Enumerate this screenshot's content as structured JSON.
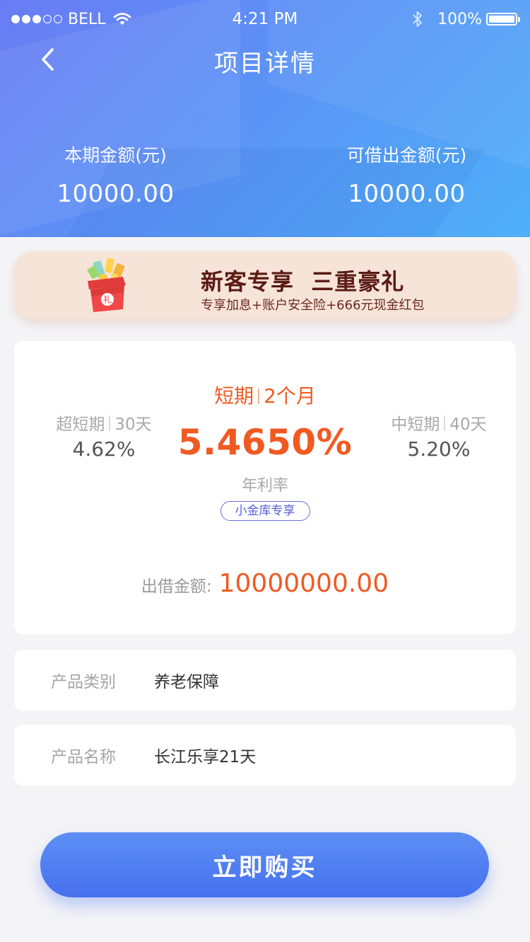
{
  "status_bar": {
    "carrier": "BELL",
    "time": "4:21 PM",
    "battery": "100%",
    "signal_bars_filled": 3,
    "signal_bars_total": 5
  },
  "nav": {
    "title": "项目详情",
    "back_icon": "chevron-left-icon"
  },
  "summary": {
    "current_amount_label": "本期金额(元)",
    "current_amount_value": "10000.00",
    "available_amount_label": "可借出金额(元)",
    "available_amount_value": "10000.00"
  },
  "promo": {
    "title_part1": "新客专享",
    "title_part2": "三重豪礼",
    "subtitle": "专享加息+账户安全险+666元现金红包",
    "gift_text": "礼"
  },
  "rate_card": {
    "current_term_name": "短期",
    "current_term_length": "2个月",
    "current_rate": "5.4650%",
    "rate_caption": "年利率",
    "badge": "小金库专享",
    "left_term_name": "超短期",
    "left_term_length": "30天",
    "left_rate": "4.62%",
    "right_term_name": "中短期",
    "right_term_length": "40天",
    "right_rate": "5.20%",
    "lend_label": "出借金额:",
    "lend_value": "10000000.00"
  },
  "info_rows": [
    {
      "label": "产品类别",
      "value": "养老保障"
    },
    {
      "label": "产品名称",
      "value": "长江乐享21天"
    }
  ],
  "buy_button": {
    "label": "立即购买"
  },
  "colors": {
    "accent_orange": "#f05a22",
    "header_gradient_start": "#6a7cf4",
    "header_gradient_end": "#4fb0f8",
    "button_blue": "#4670ee",
    "badge_purple": "#5a60d8",
    "banner_bg": "#f7e4d9",
    "banner_text": "#5a1a14"
  }
}
